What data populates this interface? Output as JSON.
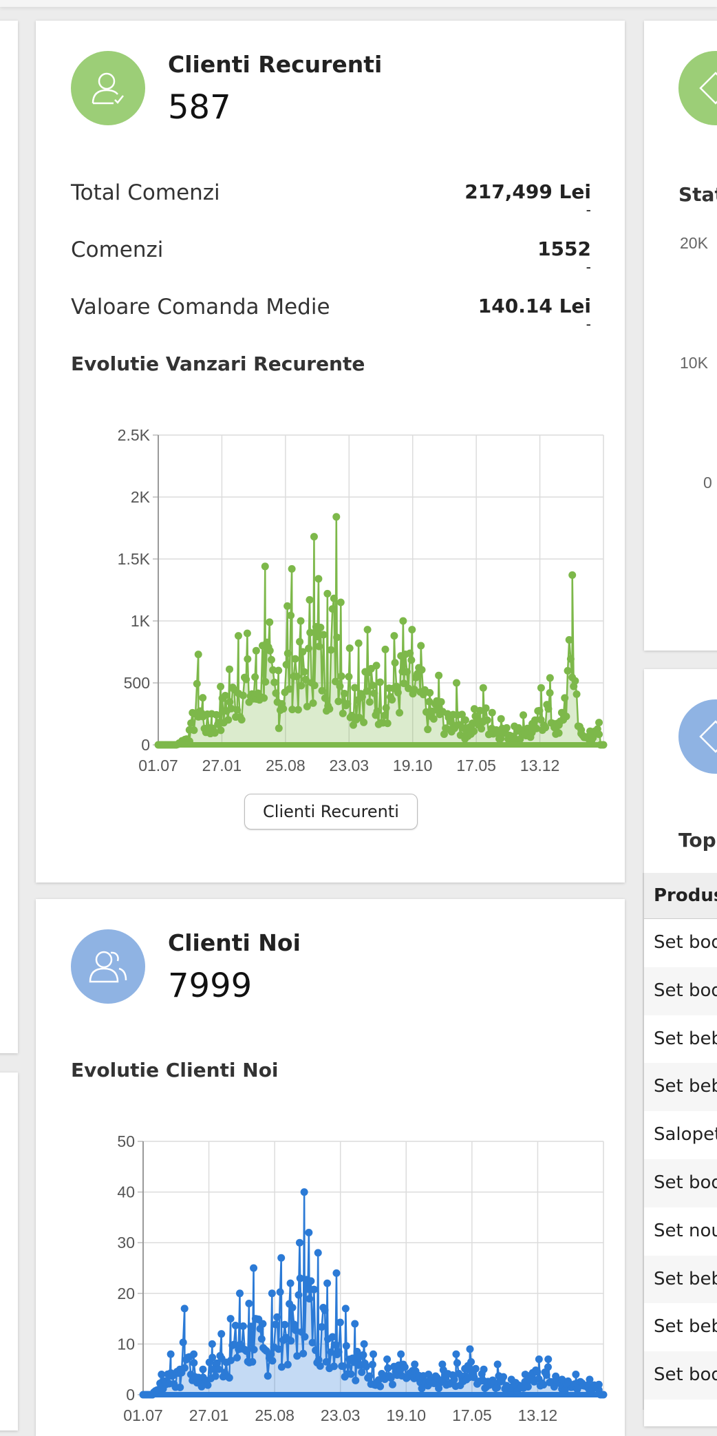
{
  "card_recurenti": {
    "title": "Clienti Recurenti",
    "count": "587",
    "accent": "#9cce77",
    "icon": "user-check-icon",
    "stats": [
      {
        "label": "Total Comenzi",
        "value": "217,499 Lei",
        "sub": "-"
      },
      {
        "label": "Comenzi",
        "value": "1552",
        "sub": "-"
      },
      {
        "label": "Valoare Comanda Medie",
        "value": "140.14 Lei",
        "sub": "-"
      }
    ],
    "chart_title": "Evolutie Vanzari Recurente",
    "button_label": "Clienti Recurenti"
  },
  "card_noi": {
    "title": "Clienti Noi",
    "count": "7999",
    "accent": "#8fb3e3",
    "icon": "users-icon",
    "chart_title": "Evolutie Clienti Noi"
  },
  "right_panel": {
    "top_label": "Stat",
    "y_ticks": [
      "20K",
      "10K",
      "0"
    ],
    "section_label": "Top",
    "table_header": "Produs",
    "rows": [
      "Set bod",
      "Set bod",
      "Set beb",
      "Set beb",
      "Salopet",
      "Set bod",
      "Set nou",
      "Set beb",
      "Set beb",
      "Set bod"
    ]
  },
  "chart_data": [
    {
      "type": "line",
      "title": "Evolutie Vanzari Recurente",
      "color": "#7db84a",
      "x_ticks": [
        "01.07",
        "27.01",
        "25.08",
        "23.03",
        "19.10",
        "17.05",
        "13.12"
      ],
      "y_ticks": [
        "0",
        "500",
        "1K",
        "1.5K",
        "2K",
        "2.5K"
      ],
      "ylim": [
        0,
        2500
      ],
      "peaks": [
        [
          0.04,
          0
        ],
        [
          0.07,
          120
        ],
        [
          0.09,
          730
        ],
        [
          0.1,
          380
        ],
        [
          0.12,
          250
        ],
        [
          0.14,
          470
        ],
        [
          0.16,
          610
        ],
        [
          0.18,
          880
        ],
        [
          0.2,
          900
        ],
        [
          0.22,
          760
        ],
        [
          0.24,
          1440
        ],
        [
          0.25,
          990
        ],
        [
          0.27,
          600
        ],
        [
          0.29,
          1120
        ],
        [
          0.3,
          1420
        ],
        [
          0.32,
          1000
        ],
        [
          0.34,
          1170
        ],
        [
          0.35,
          1680
        ],
        [
          0.36,
          1340
        ],
        [
          0.38,
          1220
        ],
        [
          0.4,
          1840
        ],
        [
          0.41,
          1150
        ],
        [
          0.43,
          780
        ],
        [
          0.45,
          820
        ],
        [
          0.47,
          930
        ],
        [
          0.49,
          640
        ],
        [
          0.51,
          770
        ],
        [
          0.53,
          880
        ],
        [
          0.55,
          1000
        ],
        [
          0.57,
          930
        ],
        [
          0.59,
          800
        ],
        [
          0.61,
          420
        ],
        [
          0.63,
          560
        ],
        [
          0.65,
          250
        ],
        [
          0.67,
          500
        ],
        [
          0.69,
          200
        ],
        [
          0.71,
          290
        ],
        [
          0.73,
          460
        ],
        [
          0.75,
          260
        ],
        [
          0.77,
          210
        ],
        [
          0.8,
          150
        ],
        [
          0.82,
          240
        ],
        [
          0.84,
          170
        ],
        [
          0.86,
          460
        ],
        [
          0.88,
          540
        ],
        [
          0.9,
          160
        ],
        [
          0.93,
          1370
        ],
        [
          0.95,
          120
        ],
        [
          0.97,
          110
        ],
        [
          0.99,
          180
        ]
      ]
    },
    {
      "type": "line",
      "title": "Evolutie Clienti Noi",
      "color": "#2b7ad6",
      "x_ticks": [
        "01.07",
        "27.01",
        "25.08",
        "23.03",
        "19.10",
        "17.05",
        "13.12"
      ],
      "y_ticks": [
        "0",
        "10",
        "20",
        "30",
        "40",
        "50"
      ],
      "ylim": [
        0,
        50
      ],
      "peaks": [
        [
          0.02,
          0
        ],
        [
          0.04,
          4
        ],
        [
          0.06,
          8
        ],
        [
          0.08,
          5
        ],
        [
          0.09,
          17
        ],
        [
          0.11,
          8
        ],
        [
          0.13,
          5
        ],
        [
          0.15,
          10
        ],
        [
          0.17,
          12
        ],
        [
          0.19,
          15
        ],
        [
          0.21,
          20
        ],
        [
          0.23,
          18
        ],
        [
          0.24,
          25
        ],
        [
          0.26,
          14
        ],
        [
          0.28,
          20
        ],
        [
          0.3,
          27
        ],
        [
          0.32,
          22
        ],
        [
          0.34,
          30
        ],
        [
          0.35,
          40
        ],
        [
          0.36,
          32
        ],
        [
          0.38,
          28
        ],
        [
          0.4,
          22
        ],
        [
          0.42,
          24
        ],
        [
          0.44,
          17
        ],
        [
          0.46,
          14
        ],
        [
          0.48,
          10
        ],
        [
          0.5,
          8
        ],
        [
          0.53,
          7
        ],
        [
          0.56,
          8
        ],
        [
          0.59,
          6
        ],
        [
          0.62,
          4
        ],
        [
          0.65,
          6
        ],
        [
          0.68,
          8
        ],
        [
          0.71,
          9
        ],
        [
          0.74,
          5
        ],
        [
          0.77,
          6
        ],
        [
          0.8,
          3
        ],
        [
          0.83,
          4
        ],
        [
          0.86,
          7
        ],
        [
          0.88,
          7
        ],
        [
          0.91,
          3
        ],
        [
          0.94,
          4
        ],
        [
          0.97,
          3
        ],
        [
          0.99,
          2
        ]
      ]
    }
  ]
}
